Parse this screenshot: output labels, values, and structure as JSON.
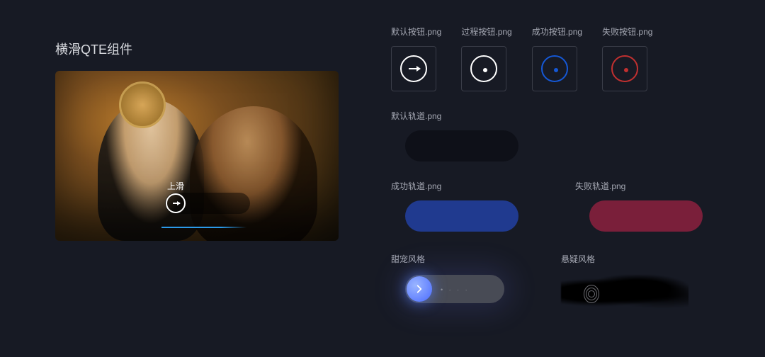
{
  "component_title": "横滑QTE组件",
  "preview": {
    "slide_label": "上滑"
  },
  "buttons": {
    "default": {
      "label": "默认按钮.png"
    },
    "process": {
      "label": "过程按钮.png"
    },
    "success": {
      "label": "成功按钮.png"
    },
    "fail": {
      "label": "失败按钮.png"
    }
  },
  "tracks": {
    "default": {
      "label": "默认轨道.png",
      "color": "#0e1018"
    },
    "success": {
      "label": "成功轨道.png",
      "color": "#203a8f"
    },
    "fail": {
      "label": "失败轨道.png",
      "color": "#7a1f3a"
    }
  },
  "styles": {
    "sweet": {
      "label": "甜宠风格"
    },
    "mystery": {
      "label": "悬疑风格"
    }
  },
  "colors": {
    "bg": "#171a24",
    "text_muted": "#a5a8b3",
    "accent_blue": "#1558d6",
    "accent_red": "#c13030",
    "progress": "#2b9ae9",
    "sweet_knob": "#4a6bff"
  }
}
